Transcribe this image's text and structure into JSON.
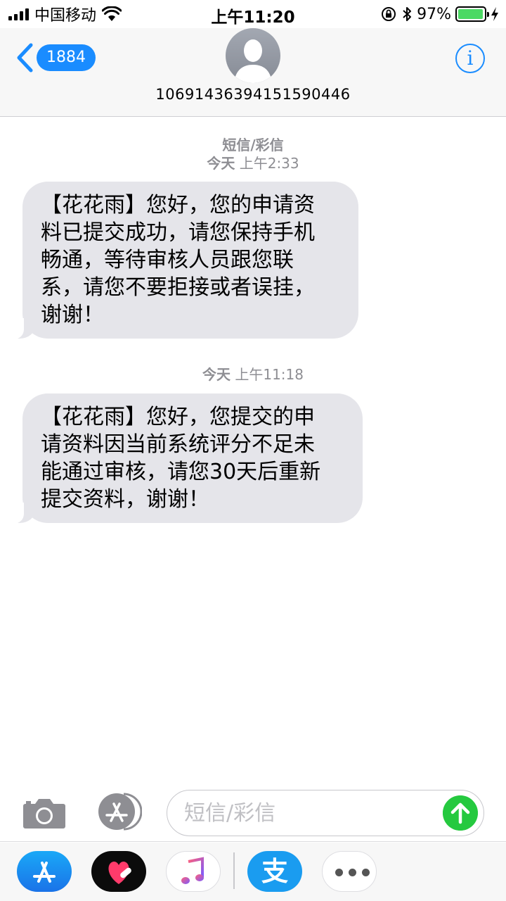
{
  "status_bar": {
    "carrier": "中国移动",
    "time": "上午11:20",
    "battery": "97%",
    "battery_level": 0.97
  },
  "header": {
    "back_count": "1884",
    "contact": "10691436394151590446",
    "info_label": "i"
  },
  "thread": {
    "service_label": "短信/彩信",
    "messages": [
      {
        "timestamp_day": "今天",
        "timestamp_time": "上午2:33",
        "lines": [
          "【花花雨】您好，您的申请资",
          "料已提交成功，请您保持手机",
          "畅通，等待审核人员跟您联",
          "系，请您不要拒接或者误挂，",
          "谢谢！"
        ]
      },
      {
        "timestamp_day": "今天",
        "timestamp_time": "上午11:18",
        "lines": [
          "【花花雨】您好，您提交的申",
          "请资料因当前系统评分不足未",
          "能通过审核，请您30天后重新",
          "提交资料，谢谢！"
        ]
      }
    ]
  },
  "composer": {
    "placeholder": "短信/彩信"
  },
  "app_drawer": {
    "alipay_glyph": "支",
    "apps": [
      "app-store-icon",
      "digital-touch-heart-icon",
      "music-icon",
      "alipay-icon",
      "more-icon"
    ]
  },
  "colors": {
    "accent": "#1a8cff",
    "bubble": "#e5e5ea",
    "send": "#25c93f",
    "battery": "#4cd964"
  }
}
